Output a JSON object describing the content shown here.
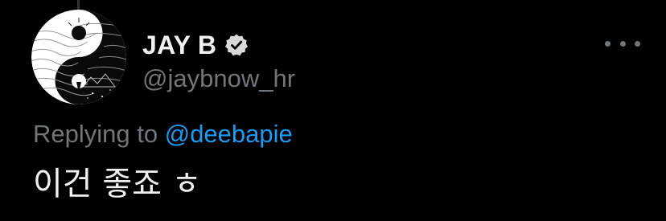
{
  "author": {
    "display_name": "JAY B",
    "handle": "@jaybnow_hr",
    "verified": true,
    "avatar_icon": "yin-yang-art-avatar"
  },
  "reply": {
    "prefix": "Replying to",
    "target": "@deebapie"
  },
  "tweet": {
    "text": "이건 좋죠 ㅎ"
  },
  "colors": {
    "background": "#000000",
    "primary_text": "#f0f0f0",
    "secondary_text": "#71767b",
    "link": "#1d9bf0"
  },
  "icons": {
    "more": "more-options-icon",
    "verified": "verified-badge-icon"
  }
}
